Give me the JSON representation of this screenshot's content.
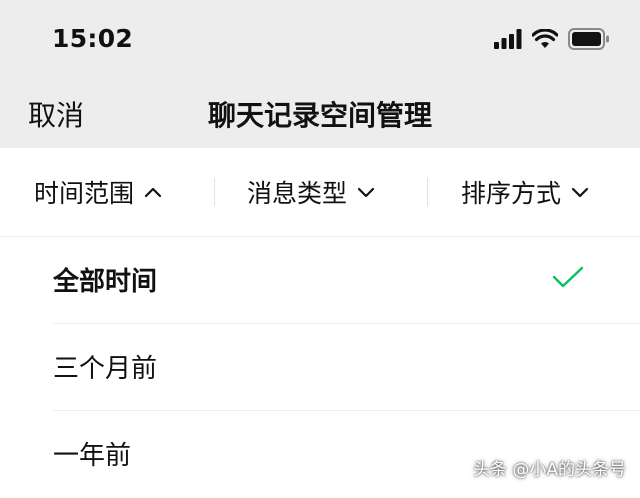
{
  "status_bar": {
    "time": "15:02",
    "icons": [
      "signal-bars-icon",
      "wifi-icon",
      "battery-icon"
    ]
  },
  "nav": {
    "cancel_label": "取消",
    "title": "聊天记录空间管理"
  },
  "filters": [
    {
      "label": "时间范围",
      "icon": "chevron-up-icon",
      "expanded": true
    },
    {
      "label": "消息类型",
      "icon": "chevron-down-icon",
      "expanded": false
    },
    {
      "label": "排序方式",
      "icon": "chevron-down-icon",
      "expanded": false
    }
  ],
  "options": [
    {
      "label": "全部时间",
      "selected": true
    },
    {
      "label": "三个月前",
      "selected": false
    },
    {
      "label": "一年前",
      "selected": false
    }
  ],
  "watermark": "头条 @小A的头条号",
  "colors": {
    "header_bg": "#ededed",
    "check_green": "#07c160",
    "text": "#111111"
  }
}
